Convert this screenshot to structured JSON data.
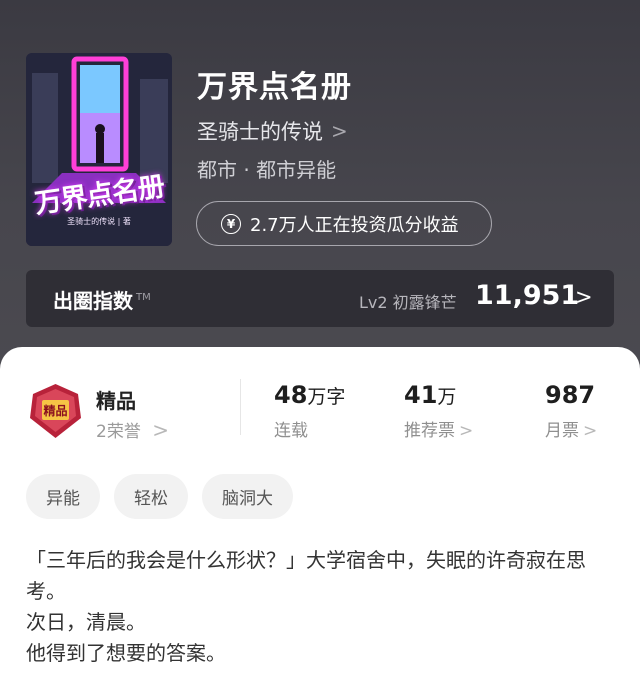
{
  "book": {
    "title": "万界点名册",
    "author": "圣骑士的传说",
    "author_chevron": ">",
    "genre": "都市 · 都市异能",
    "cover": {
      "title_art": "万界点名册",
      "author_line": "圣骑士的传说 | 著"
    }
  },
  "invest": {
    "icon": "¥",
    "text": "2.7万人正在投资瓜分收益"
  },
  "index": {
    "label": "出圈指数",
    "tm": "TM",
    "level": "Lv2 初露锋芒",
    "value": "11,951",
    "chevron": ">"
  },
  "honor": {
    "badge_text": "精品",
    "title": "精品",
    "sub": "2荣誉",
    "chevron": ">"
  },
  "stats": {
    "words": {
      "value": "48",
      "unit": "万字",
      "label": "连载"
    },
    "recommend": {
      "value": "41",
      "unit": "万",
      "label": "推荐票",
      "chevron": ">"
    },
    "monthly": {
      "value": "987",
      "label": "月票",
      "chevron": ">"
    }
  },
  "tags": [
    "异能",
    "轻松",
    "脑洞大"
  ],
  "synopsis": [
    "「三年后的我会是什么形状？」大学宿舍中，失眠的许奇寂在思考。",
    "次日，清晨。",
    "他得到了想要的答案。"
  ],
  "colors": {
    "header_bg": "#45444b",
    "index_bar_bg": "#2f2e35",
    "badge_red": "#b8223a",
    "tag_bg": "#f2f2f2"
  }
}
